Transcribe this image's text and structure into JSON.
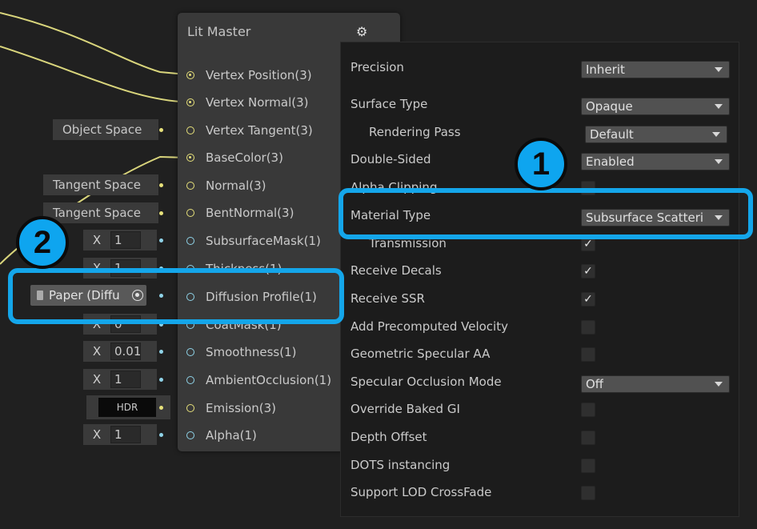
{
  "node": {
    "title": "Lit Master",
    "ports": [
      {
        "label": "Vertex Position(3)"
      },
      {
        "label": "Vertex Normal(3)"
      },
      {
        "label": "Vertex Tangent(3)"
      },
      {
        "label": "BaseColor(3)"
      },
      {
        "label": "Normal(3)"
      },
      {
        "label": "BentNormal(3)"
      },
      {
        "label": "SubsurfaceMask(1)"
      },
      {
        "label": "Thickness(1)"
      },
      {
        "label": "Diffusion Profile(1)"
      },
      {
        "label": "CoatMask(1)"
      },
      {
        "label": "Smoothness(1)"
      },
      {
        "label": "AmbientOcclusion(1)"
      },
      {
        "label": "Emission(3)"
      },
      {
        "label": "Alpha(1)"
      }
    ]
  },
  "inputs": {
    "vertex_tangent": "Object Space",
    "normal": "Tangent Space",
    "bent_normal": "Tangent Space",
    "x_label": "X",
    "subsurface_mask": "1",
    "thickness": "1",
    "diffusion_profile": "Paper (Diffu",
    "coat_mask": "0",
    "smoothness": "0.01",
    "ambient_occlusion": "1",
    "emission": "HDR",
    "alpha": "1"
  },
  "settings": {
    "precision": {
      "label": "Precision",
      "value": "Inherit"
    },
    "surface_type": {
      "label": "Surface Type",
      "value": "Opaque"
    },
    "rendering_pass": {
      "label": "Rendering Pass",
      "value": "Default"
    },
    "double_sided": {
      "label": "Double-Sided",
      "value": "Enabled"
    },
    "alpha_clipping": {
      "label": "Alpha Clipping"
    },
    "material_type": {
      "label": "Material Type",
      "value": "Subsurface Scatteri"
    },
    "transmission": {
      "label": "Transmission"
    },
    "receive_decals": {
      "label": "Receive Decals",
      "checked": true
    },
    "receive_ssr": {
      "label": "Receive SSR",
      "checked": true
    },
    "add_precomputed_velocity": {
      "label": "Add Precomputed Velocity",
      "checked": false
    },
    "geometric_specular_aa": {
      "label": "Geometric Specular AA",
      "checked": false
    },
    "specular_occlusion_mode": {
      "label": "Specular Occlusion Mode",
      "value": "Off"
    },
    "override_baked_gi": {
      "label": "Override Baked GI",
      "checked": false
    },
    "depth_offset": {
      "label": "Depth Offset",
      "checked": false
    },
    "dots_instancing": {
      "label": "DOTS instancing",
      "checked": false
    },
    "support_lod_crossfade": {
      "label": "Support LOD CrossFade",
      "checked": false
    }
  },
  "callouts": {
    "one": "1",
    "two": "2"
  },
  "colors": {
    "accent": "#14a6ea",
    "wire_yellow": "#e6e07a",
    "port_blue": "#8fd3e8"
  }
}
